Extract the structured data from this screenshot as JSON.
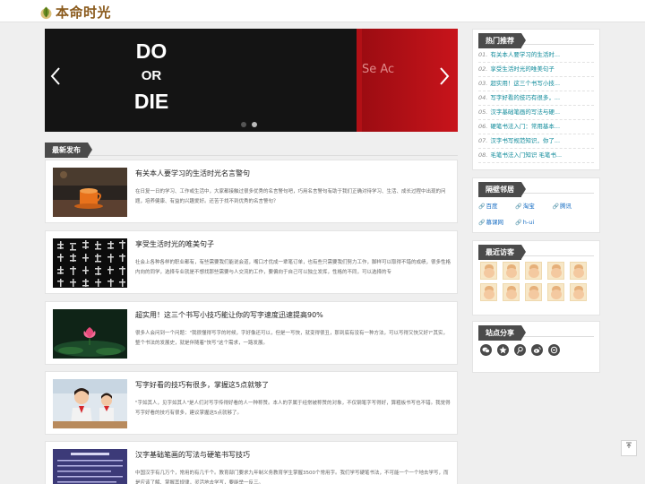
{
  "header": {
    "logo_text": "本命时光",
    "logo_icon": "leaf-icon"
  },
  "slider": {
    "slide_words": [
      "DO",
      "OR",
      "DIE"
    ],
    "side_text": "Se Ac",
    "prev_icon": "chevron-left-icon",
    "next_icon": "chevron-right-icon",
    "dot_count": 2,
    "active_dot": 2
  },
  "latest": {
    "heading": "最新发布",
    "articles": [
      {
        "title": "有关本人要学习的生活时光名言警句",
        "summary": "在日复一日的学习、工作或生活中，大家都接触过很多优秀的名言警句吧，巧用名言警句有助于我们正确对待学习、生活、成长过程中出现的问题，培养健康、有益的兴趣爱好。还苦于找不到优秀的名言警句？"
      },
      {
        "title": "享受生活时光的唯美句子",
        "summary": "社会上各种各样的职业都有，有些需要我们能说会道，嘴口才优成一辈笔订单，也有些只需要我们努力工作，脚样可以取得不错的成绩，很多性格内向的同学，选择专业就是不想找那些需要与人交流的工作，要偏向于自己可以独立发挥，性格的不同，可以选择的专"
      },
      {
        "title": "超实用！这三个书写小技巧能让你的写字速度迅速提高90%",
        "summary": "很多人会问到一个问题：\"我很懂得写字的时候，字好像还可以，但是一写快，就变得很丑，那到底有没有一种方法，可以写得又快又好?\"其实，整个书法的发展史，就是伴随着\"快写\"这个需求，一路发展。"
      },
      {
        "title": "写字好看的技巧有很多，掌握这5点就够了",
        "summary": "\"字如其人，见字如其人\"是人们对写字传得好看的人一种称赞。本人的字属于经常被称赞的对象，不仅钢笔字写得好，算粗板书写也不错。我觉得写字好看的技巧有很多，建议掌握这5点就够了。"
      },
      {
        "title": "汉字基础笔画的写法与硬笔书写技巧",
        "summary": "中国汉字有几万个，常用的有几千个。教育部门要求九年制义务教育学生掌握3500个常用字。我们学写硬笔书法，不可能一个一个地去学写，而是应该了解、掌握其规律，灵活地去学写，要能举一反三。"
      }
    ]
  },
  "sidebar": {
    "hot": {
      "heading": "热门推荐",
      "items": [
        {
          "num": "01.",
          "label": "有关本人要学习的生活时..."
        },
        {
          "num": "02.",
          "label": "享受生活时光的唯美句子"
        },
        {
          "num": "03.",
          "label": "超实用！这三个书写小技..."
        },
        {
          "num": "04.",
          "label": "写字好看的技巧有很多，..."
        },
        {
          "num": "05.",
          "label": "汉字基础笔画的写法与硬..."
        },
        {
          "num": "06.",
          "label": "硬笔书法入门：常用基本..."
        },
        {
          "num": "07.",
          "label": "汉字书写规范知识，你了..."
        },
        {
          "num": "08.",
          "label": "毛笔书法入门知识 毛笔书..."
        }
      ]
    },
    "links": {
      "heading": "隔壁邻居",
      "items": [
        "百度",
        "淘宝",
        "腾讯",
        "慕课网",
        "h-ui"
      ]
    },
    "visitors": {
      "heading": "最近访客",
      "count": 10
    },
    "share": {
      "heading": "站点分享",
      "icons": [
        "wechat-icon",
        "qzone-icon",
        "tencent-weibo-icon",
        "sina-weibo-icon",
        "zhihu-icon"
      ]
    }
  },
  "backtop_icon": "back-to-top-icon"
}
